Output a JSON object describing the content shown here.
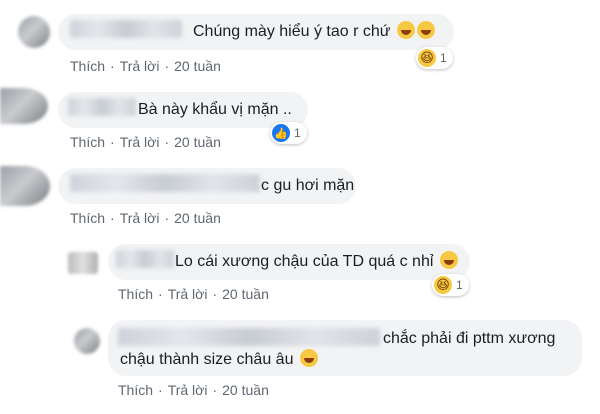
{
  "actions": {
    "like": "Thích",
    "reply": "Trả lời",
    "sep": "·"
  },
  "comments": [
    {
      "text": "Chúng mày hiểu ý tao r chứ",
      "time": "20 tuần",
      "reaction_count": "1",
      "reaction": "haha-icon"
    },
    {
      "text": "Bà này khẩu vị mặn ..",
      "time": "20 tuần",
      "reaction_count": "1",
      "reaction": "like-icon"
    },
    {
      "text": "c gu hơi mặn",
      "time": "20 tuần"
    },
    {
      "text": "Lo cái xương chậu của TD quá c nhỉ",
      "time": "20 tuần",
      "reaction_count": "1",
      "reaction": "haha-icon"
    },
    {
      "text_line1": "chắc phải đi pttm xương",
      "text_line2": "chậu thành size châu âu",
      "time": "20 tuần"
    }
  ],
  "colors": {
    "bubble": "#f2f3f5",
    "action_text": "#606770",
    "like_blue": "#1877f2",
    "haha_yellow": "#f7c943"
  }
}
